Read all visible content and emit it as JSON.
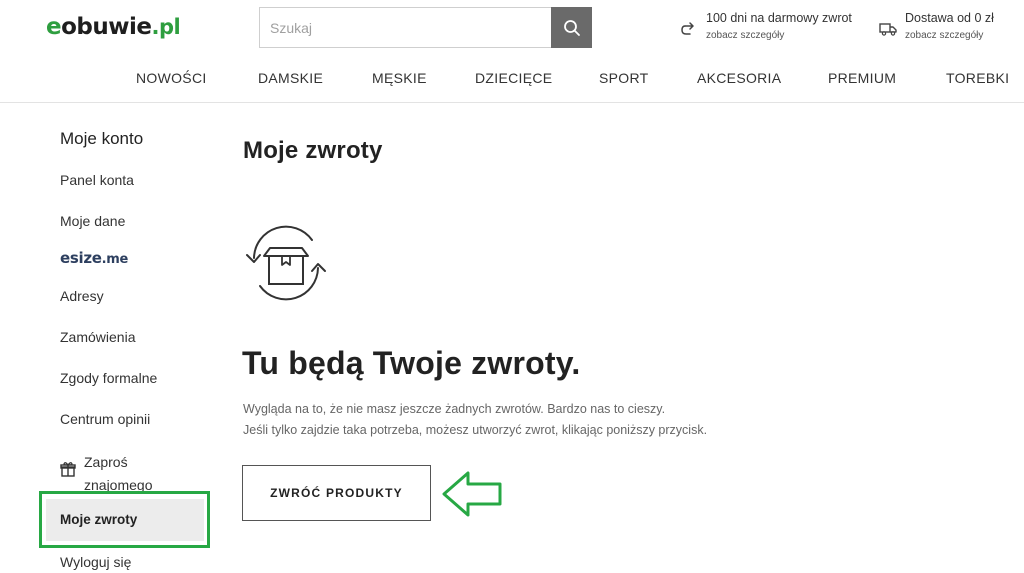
{
  "header": {
    "logo": {
      "prefix": "e",
      "main": "obuwie",
      "suffix": ".pl"
    },
    "search": {
      "placeholder": "Szukaj",
      "button_icon": "search-icon"
    },
    "perks": [
      {
        "icon": "return-arrow-icon",
        "title": "100 dni na darmowy zwrot",
        "link": "zobacz szczegóły"
      },
      {
        "icon": "delivery-truck-icon",
        "title": "Dostawa od 0 zł",
        "link": "zobacz szczegóły"
      }
    ]
  },
  "nav": [
    "NOWOŚCI",
    "DAMSKIE",
    "MĘSKIE",
    "DZIECIĘCE",
    "SPORT",
    "AKCESORIA",
    "PREMIUM",
    "TOREBKI"
  ],
  "sidebar": {
    "title": "Moje konto",
    "items": [
      "Panel konta",
      "Moje dane",
      "Adresy",
      "Zamówienia",
      "Zgody formalne",
      "Centrum opinii"
    ],
    "esize": {
      "main": "esize",
      "suffix": ".me"
    },
    "invite": {
      "icon": "gift-icon",
      "label": "Zaproś znajomego"
    },
    "active": "Moje zwroty",
    "logout": "Wyloguj się",
    "highlight_color": "#27a844"
  },
  "main": {
    "title": "Moje zwroty",
    "illustration_icon": "box-return-icon",
    "empty_heading": "Tu będą Twoje zwroty.",
    "empty_line1": "Wygląda na to, że nie masz jeszcze żadnych zwrotów. Bardzo nas to cieszy.",
    "empty_line2": "Jeśli tylko zajdzie taka potrzeba, możesz utworzyć zwrot, klikając poniższy przycisk.",
    "button_label": "ZWRÓĆ PRODUKTY",
    "pointer_icon": "left-arrow-outline-icon"
  },
  "colors": {
    "brand_green": "#2e9e3f",
    "highlight_green": "#27a844",
    "search_button": "#6a6a6a",
    "active_bg": "#ececec"
  }
}
